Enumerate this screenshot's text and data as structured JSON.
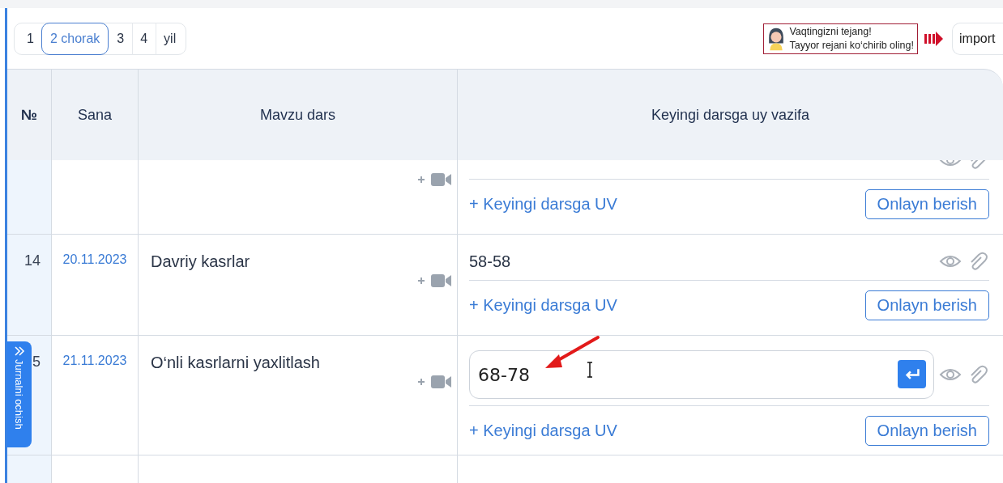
{
  "period_tabs": [
    {
      "label": "1",
      "selected": false
    },
    {
      "label": "2 chorak",
      "selected": true
    },
    {
      "label": "3",
      "selected": false
    },
    {
      "label": "4",
      "selected": false
    },
    {
      "label": "yil",
      "selected": false
    }
  ],
  "promo": {
    "lines": [
      "Vaqtingizni tejang!",
      "Tayyor rejani ko‘chirib oling!"
    ]
  },
  "import_button": "import",
  "table": {
    "columns": [
      "№",
      "Sana",
      "Mavzu dars",
      "Keyingi darsga uy vazifa"
    ],
    "rows": [
      {
        "homework": {
          "kind": "none"
        },
        "add_link": "+ Keyingi darsga UV",
        "online_button": "Onlayn berish"
      },
      {
        "number": "14",
        "date": "20.11.2023",
        "topic": "Davriy kasrlar",
        "homework": {
          "kind": "text",
          "value": "58-58"
        },
        "add_link": "+ Keyingi darsga UV",
        "online_button": "Onlayn berish"
      },
      {
        "number": "5",
        "date": "21.11.2023",
        "topic": "O‘nli kasrlarni yaxlitlash",
        "homework": {
          "kind": "input",
          "value": "68-78"
        },
        "add_link": "+ Keyingi darsga UV",
        "online_button": "Onlayn berish"
      }
    ]
  },
  "side_tab": "Jurnalni ochish"
}
